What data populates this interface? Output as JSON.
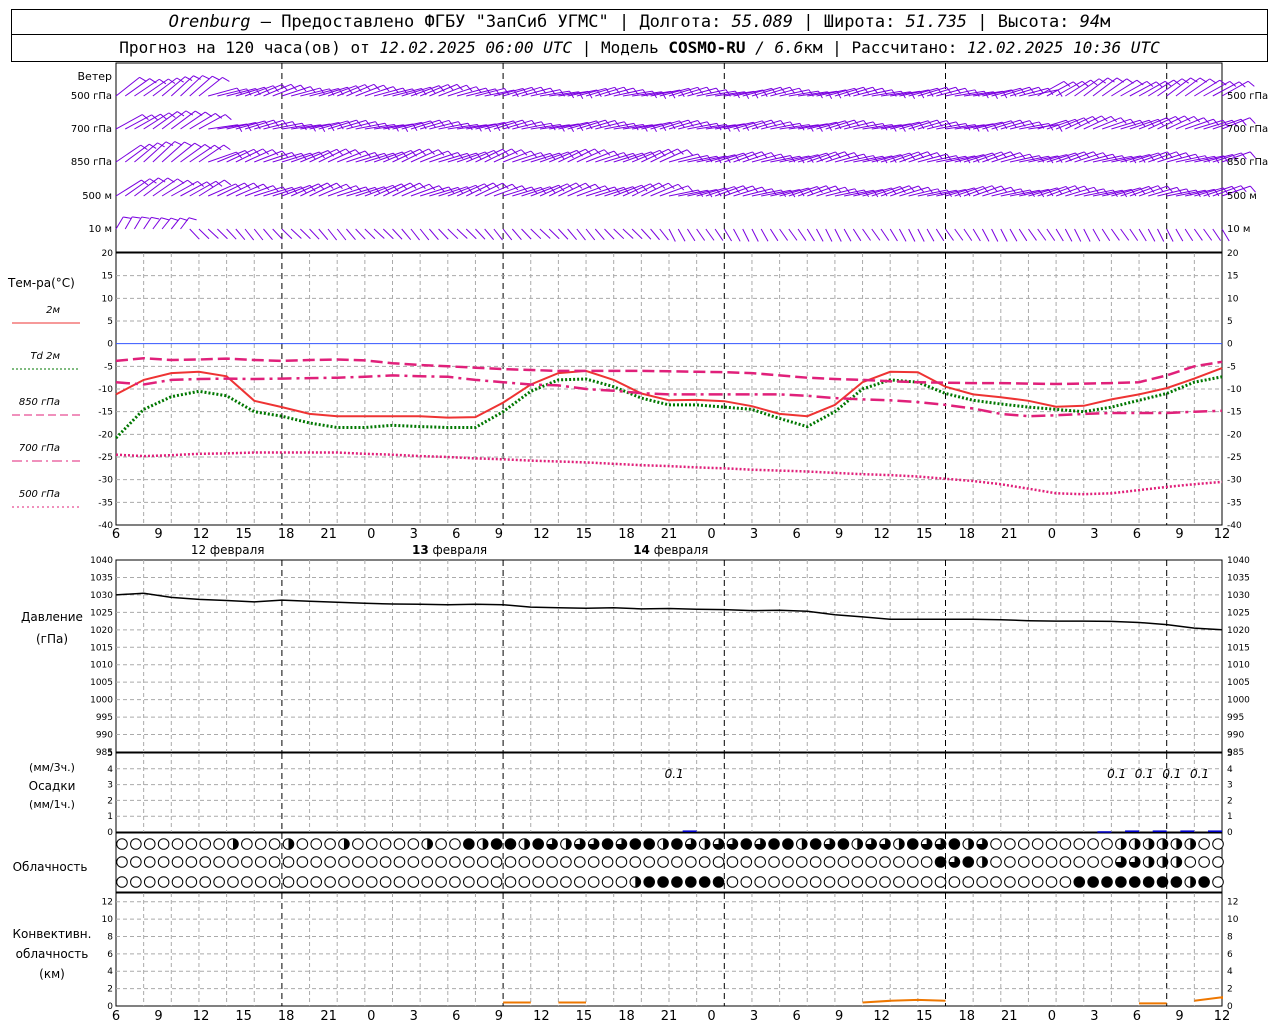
{
  "header": {
    "city": "Orenburg",
    "provider": "— Предоставлено ФГБУ \"ЗапСиб УГМС\" |",
    "lon_label": "Долгота:",
    "lon": "55.089",
    "lat_label": "| Широта:",
    "lat": "51.735",
    "alt_label": "| Высота:",
    "alt": "94",
    "alt_unit": "м",
    "forecast_label": "Прогноз на 120 часа(ов) от",
    "forecast_start": "12.02.2025 06:00 UTC",
    "model_label": "| Модель",
    "model": "COSMO-RU",
    "model_res": "/ 6.6",
    "model_res_unit": "км",
    "calc_label": "| Рассчитано:",
    "calc_time": "12.02.2025 10:36 UTC"
  },
  "time_axis": {
    "hour_labels": [
      "6",
      "9",
      "12",
      "15",
      "18",
      "21",
      "0",
      "3",
      "6",
      "9",
      "12",
      "15",
      "18",
      "21",
      "0",
      "3",
      "6",
      "9",
      "12",
      "15",
      "18",
      "21",
      "0",
      "3",
      "6",
      "9",
      "12"
    ],
    "date_labels": [
      {
        "hour_index": 7,
        "text": "12 февраля",
        "bold_prefix": ""
      },
      {
        "hour_index": 31,
        "text": " февраля",
        "bold_prefix": "13"
      },
      {
        "hour_index": 55,
        "text": " февраля",
        "bold_prefix": "14"
      }
    ]
  },
  "wind_panel": {
    "title": "Ветер",
    "levels": [
      "500 гПа",
      "700 гПа",
      "850 гПа",
      "500 м",
      "10  м"
    ],
    "color": "#7a00e0"
  },
  "temp_panel": {
    "title": "Тем-ра(°C)",
    "legend": [
      {
        "label": "2м",
        "color": "#ee3333",
        "style": "solid"
      },
      {
        "label": "Td  2м",
        "color": "#007700",
        "style": "dotted"
      },
      {
        "label": "850 гПа",
        "color": "#e0207a",
        "style": "dashed"
      },
      {
        "label": "700 гПа",
        "color": "#e0207a",
        "style": "dashdot"
      },
      {
        "label": "500 гПа",
        "color": "#e0207a",
        "style": "dots"
      }
    ]
  },
  "pressure_panel": {
    "title": "Давление",
    "unit": "(гПа)"
  },
  "precip_panel": {
    "title": "Осадки",
    "unit_top": "(мм/3ч.)",
    "unit_bottom": "(мм/1ч.)",
    "labels": [
      {
        "hour": 63,
        "text": "0.1"
      },
      {
        "hour": 111,
        "text": "0.1"
      },
      {
        "hour": 114,
        "text": "0.1"
      },
      {
        "hour": 117,
        "text": "0.1"
      },
      {
        "hour": 120,
        "text": "0.1"
      }
    ]
  },
  "cloud_panel": {
    "title": "Облачность"
  },
  "conv_panel": {
    "title_line1": "Конвективн.",
    "title_line2": "облачность",
    "unit": "(км)"
  },
  "chart_data": [
    {
      "type": "line",
      "title": "Тем-ра(°C)",
      "x_unit": "hours since 12.02.2025 06:00 UTC",
      "ylim": [
        -40,
        20
      ],
      "yticks": [
        20,
        15,
        10,
        5,
        0,
        -5,
        -10,
        -15,
        -20,
        -25,
        -30,
        -35,
        -40
      ],
      "grid": true,
      "series": [
        {
          "name": "2м",
          "x": [
            0,
            3,
            6,
            9,
            12,
            15,
            18,
            21,
            24,
            27,
            30,
            33,
            36,
            39,
            42,
            45,
            48,
            51,
            54,
            57,
            60,
            63,
            66,
            69,
            72,
            75,
            78,
            81,
            84,
            87,
            90,
            93,
            96,
            99,
            102,
            105,
            108,
            111,
            114,
            117,
            120
          ],
          "values": [
            -11.2,
            -8,
            -6.5,
            -6.2,
            -7.2,
            -12.6,
            -14,
            -15.5,
            -16,
            -16,
            -16,
            -16,
            -16.3,
            -16.2,
            -13,
            -9,
            -6.5,
            -6,
            -8,
            -11,
            -12.5,
            -12.4,
            -12.7,
            -13.8,
            -15.5,
            -16,
            -13.5,
            -8.5,
            -6.2,
            -6.3,
            -9.5,
            -11.2,
            -11.8,
            -12.6,
            -13.9,
            -13.7,
            -12.3,
            -11.2,
            -9.8,
            -7.7,
            -5.4
          ]
        },
        {
          "name": "Td  2м",
          "x": [
            0,
            3,
            6,
            9,
            12,
            15,
            18,
            21,
            24,
            27,
            30,
            33,
            36,
            39,
            42,
            45,
            48,
            51,
            54,
            57,
            60,
            63,
            66,
            69,
            72,
            75,
            78,
            81,
            84,
            87,
            90,
            93,
            96,
            99,
            102,
            105,
            108,
            111,
            114,
            117,
            120
          ],
          "values": [
            -20.8,
            -14.5,
            -11.7,
            -10.5,
            -11.5,
            -15,
            -16,
            -17.5,
            -18.5,
            -18.5,
            -18,
            -18.3,
            -18.5,
            -18.5,
            -15,
            -10.5,
            -8,
            -7.8,
            -9.5,
            -12,
            -13.5,
            -13.5,
            -14,
            -14.5,
            -16.5,
            -18.3,
            -15,
            -10,
            -8,
            -8.5,
            -11,
            -12.5,
            -13.3,
            -14,
            -14.5,
            -15,
            -14,
            -12.5,
            -11,
            -8.5,
            -7.3
          ]
        },
        {
          "name": "850 гПа",
          "x": [
            0,
            3,
            6,
            9,
            12,
            15,
            18,
            21,
            24,
            27,
            30,
            33,
            36,
            39,
            42,
            45,
            48,
            51,
            54,
            57,
            60,
            63,
            66,
            69,
            72,
            75,
            78,
            81,
            84,
            87,
            90,
            93,
            96,
            99,
            102,
            105,
            108,
            111,
            114,
            117,
            120
          ],
          "values": [
            -3.8,
            -3.2,
            -3.6,
            -3.5,
            -3.3,
            -3.6,
            -3.8,
            -3.6,
            -3.5,
            -3.7,
            -4.3,
            -4.7,
            -5,
            -5.3,
            -5.6,
            -5.8,
            -6,
            -6,
            -6,
            -6,
            -6.1,
            -6.2,
            -6.3,
            -6.5,
            -7,
            -7.5,
            -7.8,
            -8,
            -8.3,
            -8.5,
            -8.6,
            -8.7,
            -8.7,
            -8.8,
            -8.9,
            -8.8,
            -8.7,
            -8.5,
            -7,
            -5,
            -4
          ]
        },
        {
          "name": "700 гПа",
          "x": [
            0,
            3,
            6,
            9,
            12,
            15,
            18,
            21,
            24,
            27,
            30,
            33,
            36,
            39,
            42,
            45,
            48,
            51,
            54,
            57,
            60,
            63,
            66,
            69,
            72,
            75,
            78,
            81,
            84,
            87,
            90,
            93,
            96,
            99,
            102,
            105,
            108,
            111,
            114,
            117,
            120
          ],
          "values": [
            -8.5,
            -9,
            -8,
            -7.8,
            -7.7,
            -7.8,
            -7.7,
            -7.6,
            -7.5,
            -7.3,
            -7,
            -7.2,
            -7.3,
            -8,
            -8.5,
            -9,
            -9.2,
            -10,
            -10.4,
            -10.9,
            -11.2,
            -11.2,
            -11.2,
            -11.2,
            -11.2,
            -11.5,
            -12,
            -12.3,
            -12.5,
            -12.9,
            -13.5,
            -14.3,
            -15.5,
            -16,
            -15.8,
            -15.5,
            -15.3,
            -15.3,
            -15.3,
            -15,
            -14.8
          ]
        },
        {
          "name": "500 гПа",
          "x": [
            0,
            3,
            6,
            9,
            12,
            15,
            18,
            21,
            24,
            27,
            30,
            33,
            36,
            39,
            42,
            45,
            48,
            51,
            54,
            57,
            60,
            63,
            66,
            69,
            72,
            75,
            78,
            81,
            84,
            87,
            90,
            93,
            96,
            99,
            102,
            105,
            108,
            111,
            114,
            117,
            120
          ],
          "values": [
            -24.5,
            -24.8,
            -24.6,
            -24.3,
            -24.2,
            -24,
            -24,
            -24,
            -24,
            -24.3,
            -24.5,
            -24.8,
            -25,
            -25.3,
            -25.5,
            -25.8,
            -26,
            -26.2,
            -26.5,
            -26.8,
            -27,
            -27.3,
            -27.5,
            -27.8,
            -28,
            -28.2,
            -28.5,
            -28.8,
            -29,
            -29.3,
            -29.8,
            -30.3,
            -31,
            -32,
            -33,
            -33.2,
            -33,
            -32.3,
            -31.6,
            -31,
            -30.5
          ]
        }
      ]
    },
    {
      "type": "line",
      "title": "Давление",
      "ylabel": "(гПа)",
      "x_unit": "hours since 12.02.2025 06:00 UTC",
      "ylim": [
        985,
        1040
      ],
      "yticks": [
        1040,
        1035,
        1030,
        1025,
        1020,
        1015,
        1010,
        1005,
        1000,
        995,
        990,
        985
      ],
      "grid": true,
      "series": [
        {
          "name": "Давление",
          "x": [
            0,
            3,
            6,
            9,
            12,
            15,
            18,
            21,
            24,
            27,
            30,
            33,
            36,
            39,
            42,
            45,
            48,
            51,
            54,
            57,
            60,
            63,
            66,
            69,
            72,
            75,
            78,
            81,
            84,
            87,
            90,
            93,
            96,
            99,
            102,
            105,
            108,
            111,
            114,
            117,
            120
          ],
          "values": [
            1030,
            1030.5,
            1029.3,
            1028.7,
            1028.4,
            1028,
            1028.5,
            1028.2,
            1027.9,
            1027.6,
            1027.4,
            1027.3,
            1027.2,
            1027.3,
            1027.2,
            1026.5,
            1026.3,
            1026.2,
            1026.3,
            1026,
            1026.1,
            1025.9,
            1025.8,
            1025.5,
            1025.6,
            1025.3,
            1024.3,
            1023.7,
            1023,
            1023,
            1023,
            1023,
            1022.9,
            1022.6,
            1022.5,
            1022.5,
            1022.4,
            1022.1,
            1021.5,
            1020.5,
            1020
          ]
        }
      ]
    },
    {
      "type": "bar",
      "title": "Осадки",
      "ylabel": "(мм/3ч.) (мм/1ч.)",
      "x_unit": "hours since 12.02.2025 06:00 UTC",
      "ylim": [
        0,
        5
      ],
      "yticks": [
        0,
        1,
        2,
        3,
        4,
        5
      ],
      "x": [
        63,
        108,
        111,
        114,
        117,
        120
      ],
      "values": [
        0.1,
        0.05,
        0.1,
        0.1,
        0.1,
        0.1
      ],
      "color": "#0000cc"
    },
    {
      "type": "line",
      "title": "Конвективн. облачность",
      "ylabel": "(км)",
      "x_unit": "hours since 12.02.2025 06:00 UTC",
      "ylim": [
        0,
        13
      ],
      "yticks": [
        0,
        2,
        4,
        6,
        8,
        10,
        12
      ],
      "color": "#ee7700",
      "segments": [
        {
          "x": [
            42,
            45
          ],
          "values": [
            0.4,
            0.4
          ]
        },
        {
          "x": [
            48,
            51
          ],
          "values": [
            0.4,
            0.4
          ]
        },
        {
          "x": [
            81,
            84,
            87,
            90
          ],
          "values": [
            0.4,
            0.6,
            0.7,
            0.6
          ]
        },
        {
          "x": [
            111,
            114
          ],
          "values": [
            0.3,
            0.3
          ]
        },
        {
          "x": [
            117,
            120,
            122
          ],
          "values": [
            0.6,
            1.0,
            0.8
          ]
        }
      ]
    }
  ]
}
